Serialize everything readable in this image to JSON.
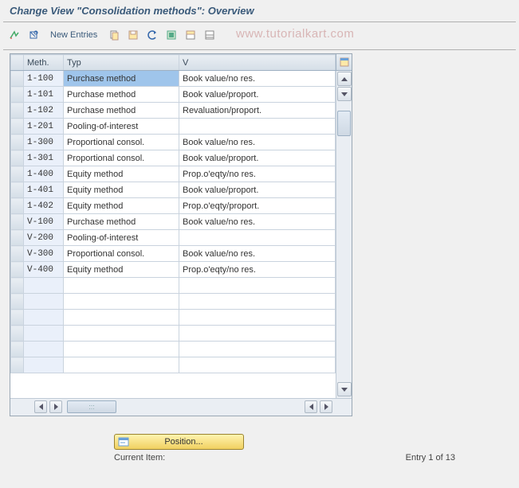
{
  "title": "Change View \"Consolidation methods\": Overview",
  "watermark": "www.tutorialkart.com",
  "toolbar": {
    "new_entries_label": "New Entries"
  },
  "columns": {
    "meth": "Meth.",
    "typ": "Typ",
    "var": "V"
  },
  "rows": [
    {
      "meth": "1-100",
      "typ": "Purchase method",
      "var": "Book value/no res.",
      "selected_typ": true
    },
    {
      "meth": "1-101",
      "typ": "Purchase method",
      "var": "Book value/proport."
    },
    {
      "meth": "1-102",
      "typ": "Purchase method",
      "var": "Revaluation/proport."
    },
    {
      "meth": "1-201",
      "typ": "Pooling-of-interest",
      "var": ""
    },
    {
      "meth": "1-300",
      "typ": "Proportional consol.",
      "var": "Book value/no res."
    },
    {
      "meth": "1-301",
      "typ": "Proportional consol.",
      "var": "Book value/proport."
    },
    {
      "meth": "1-400",
      "typ": "Equity method",
      "var": "Prop.o'eqty/no res."
    },
    {
      "meth": "1-401",
      "typ": "Equity method",
      "var": "Book value/proport."
    },
    {
      "meth": "1-402",
      "typ": "Equity method",
      "var": "Prop.o'eqty/proport."
    },
    {
      "meth": "V-100",
      "typ": "Purchase method",
      "var": "Book value/no res."
    },
    {
      "meth": "V-200",
      "typ": "Pooling-of-interest",
      "var": ""
    },
    {
      "meth": "V-300",
      "typ": "Proportional consol.",
      "var": "Book value/no res."
    },
    {
      "meth": "V-400",
      "typ": "Equity method",
      "var": "Prop.o'eqty/no res."
    },
    {
      "meth": "",
      "typ": "",
      "var": ""
    },
    {
      "meth": "",
      "typ": "",
      "var": ""
    },
    {
      "meth": "",
      "typ": "",
      "var": ""
    },
    {
      "meth": "",
      "typ": "",
      "var": ""
    },
    {
      "meth": "",
      "typ": "",
      "var": ""
    },
    {
      "meth": "",
      "typ": "",
      "var": ""
    }
  ],
  "footer": {
    "position_label": "Position...",
    "current_item_label": "Current Item:",
    "entry_text": "Entry 1 of 13"
  }
}
